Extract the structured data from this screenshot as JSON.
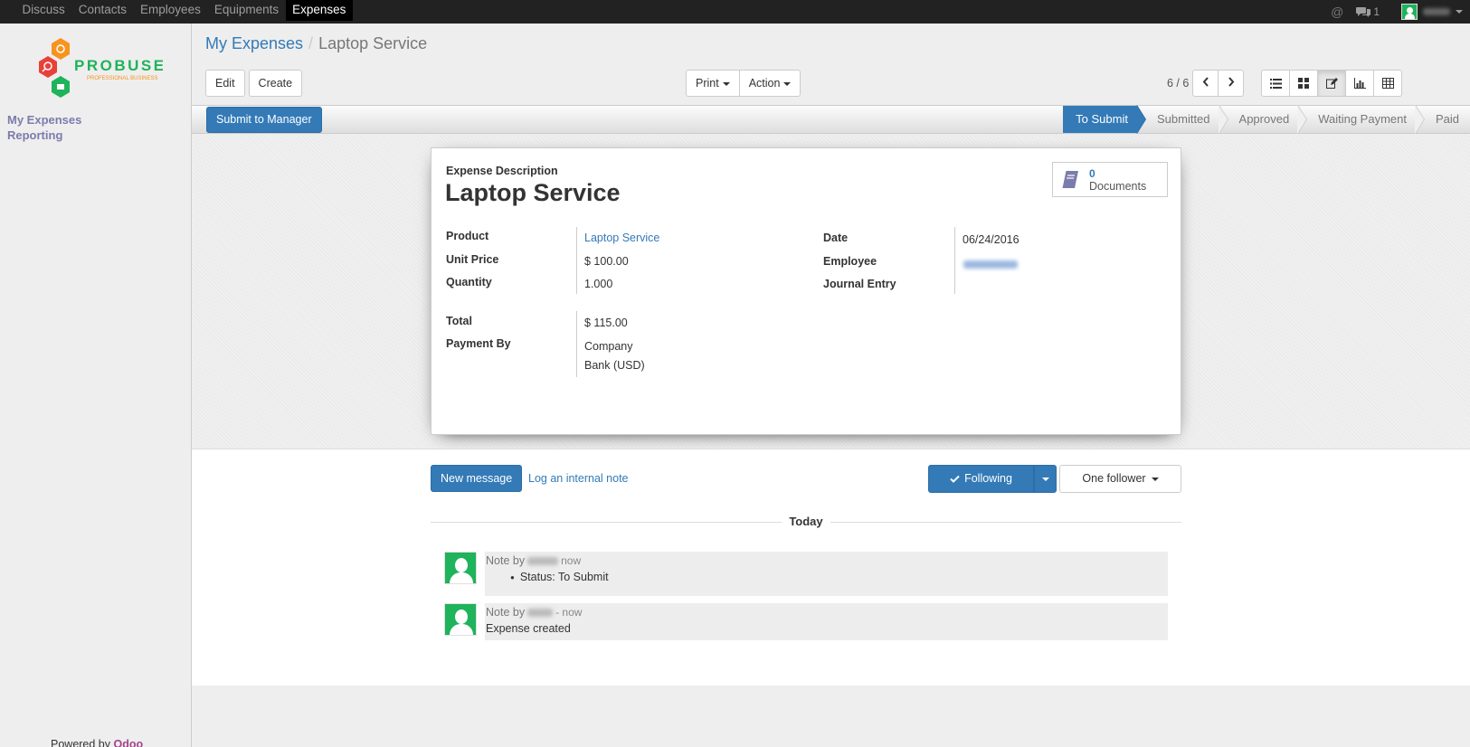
{
  "topmenu": {
    "items": [
      {
        "label": "Discuss"
      },
      {
        "label": "Contacts"
      },
      {
        "label": "Employees"
      },
      {
        "label": "Equipments"
      },
      {
        "label": "Expenses"
      }
    ],
    "active_index": 4,
    "at_icon": "@",
    "chat_count": "1"
  },
  "sidebar": {
    "logo_text": "PROBUSE",
    "logo_sub": "PROFESSIONAL BUSINESS",
    "items": [
      {
        "label": "My Expenses"
      },
      {
        "label": "Reporting"
      }
    ],
    "powered_prefix": "Powered by ",
    "powered_brand": "Odoo"
  },
  "breadcrumb": {
    "parent": "My Expenses",
    "separator": "/",
    "current": "Laptop Service"
  },
  "toolbar": {
    "edit_label": "Edit",
    "create_label": "Create",
    "print_label": "Print",
    "action_label": "Action",
    "pager": "6 / 6"
  },
  "statusbar": {
    "submit_label": "Submit to Manager",
    "stages": [
      {
        "label": "To Submit",
        "active": true
      },
      {
        "label": "Submitted"
      },
      {
        "label": "Approved"
      },
      {
        "label": "Waiting Payment"
      },
      {
        "label": "Paid"
      }
    ]
  },
  "form": {
    "description_label": "Expense Description",
    "title": "Laptop Service",
    "documents": {
      "count": "0",
      "label": "Documents"
    },
    "product_label": "Product",
    "product_value": "Laptop Service",
    "unit_price_label": "Unit Price",
    "unit_price_value": "$ 100.00",
    "quantity_label": "Quantity",
    "quantity_value": "1.000",
    "total_label": "Total",
    "total_value": "$ 115.00",
    "payment_by_label": "Payment By",
    "payment_by_line1": "Company",
    "payment_by_line2": "Bank (USD)",
    "date_label": "Date",
    "date_value": "06/24/2016",
    "employee_label": "Employee",
    "journal_label": "Journal Entry"
  },
  "chatter": {
    "new_message_label": "New message",
    "log_note_label": "Log an internal note",
    "following_label": "Following",
    "followers_label": "One follower",
    "today_label": "Today",
    "messages": [
      {
        "prefix": "Note by",
        "time": "now",
        "text": "Status: To Submit"
      },
      {
        "prefix": "Note by",
        "time": "- now",
        "text": "Expense created"
      }
    ]
  },
  "colors": {
    "accent": "#337ab7",
    "topbar": "#222222",
    "sidebar_link": "#7c7bad",
    "odoo_brand": "#a24689"
  }
}
